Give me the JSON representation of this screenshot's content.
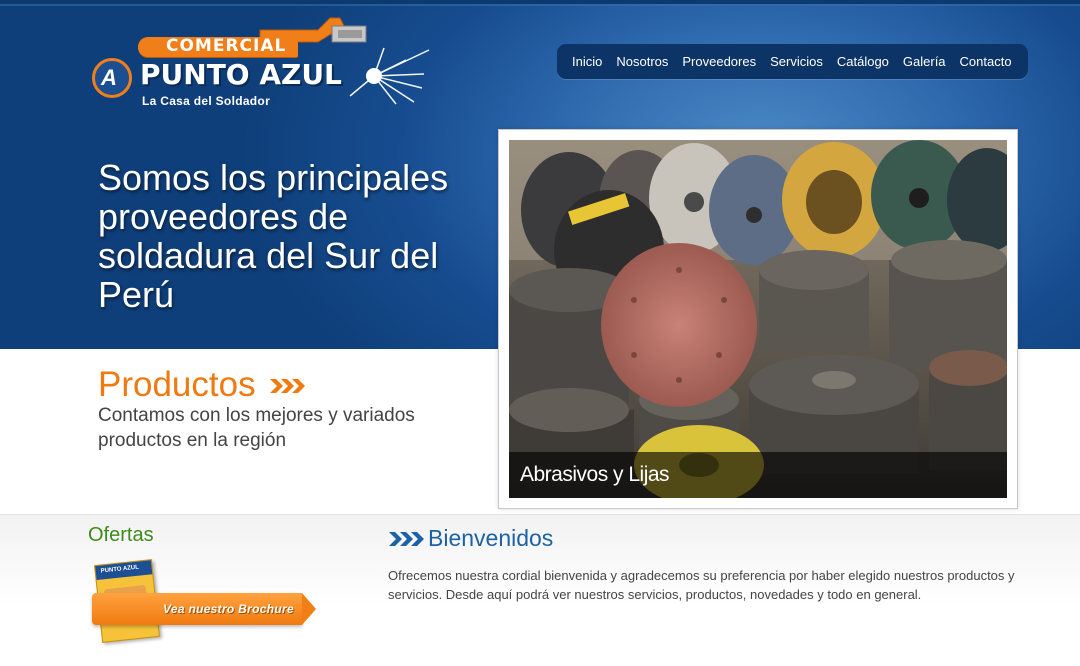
{
  "brand": {
    "top_label": "COMERCIAL",
    "name": "PUNTO AZUL",
    "tagline": "La Casa del Soldador",
    "monogram": "A"
  },
  "nav": {
    "items": [
      "Inicio",
      "Nosotros",
      "Proveedores",
      "Servicios",
      "Catálogo",
      "Galería",
      "Contacto"
    ]
  },
  "hero": {
    "title": "Somos los principales proveedores de soldadura del Sur del Perú"
  },
  "productos": {
    "title": "Productos",
    "arrow_icon": "triple-chevron-right-icon",
    "description": "Contamos con los mejores y variados productos en la región"
  },
  "slider": {
    "caption": "Abrasivos y Lijas"
  },
  "ofertas": {
    "title": "Ofertas",
    "brochure_button": "Vea nuestro Brochure",
    "brochure_card_label": "PUNTO AZUL"
  },
  "bienvenidos": {
    "title": "Bienvenidos",
    "text": "Ofrecemos nuestra cordial bienvenida y agradecemos su preferencia por haber elegido nuestros productos y servicios. Desde aquí podrá ver nuestros servicios, productos, novedades y todo en general."
  },
  "colors": {
    "hero_blue": "#164c8f",
    "nav_bg": "#0d3466",
    "accent_orange": "#f07a10",
    "ofertas_green": "#3f8a1f",
    "bienvenidos_blue": "#1d62a5"
  }
}
